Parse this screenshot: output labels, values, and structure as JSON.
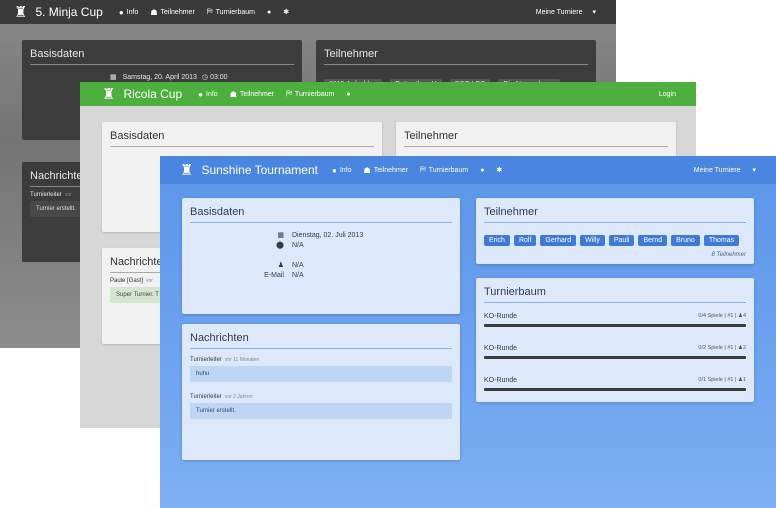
{
  "w1": {
    "title": "5. Minja Cup",
    "nav": [
      "Info",
      "Teilnehmer",
      "Turnierbaum"
    ],
    "user_menu": "Meine Turniere",
    "basis_title": "Basisdaten",
    "date": "Samstag, 20. April 2013",
    "time": "03:00",
    "participants_title": "Teilnehmer",
    "participants": [
      "0815 Aufschlag",
      "Better than U",
      "BSG LBS",
      "Die Namenlosen"
    ],
    "messages_title": "Nachrichten",
    "msg_author": "Turnierleiter",
    "msg_time": "vor",
    "msg_text": "Turnier erstellt."
  },
  "w2": {
    "title": "Ricola Cup",
    "nav": [
      "Info",
      "Teilnehmer",
      "Turnierbaum"
    ],
    "login": "Login",
    "basis_title": "Basisdaten",
    "participants_title": "Teilnehmer",
    "messages_title": "Nachrichten",
    "msg_author": "Paule [Gast]",
    "msg_time": "vor",
    "msg_text": "Super Turnier. T"
  },
  "w3": {
    "title": "Sunshine Tournament",
    "nav": [
      "Info",
      "Teilnehmer",
      "Turnierbaum"
    ],
    "user_menu": "Meine Turniere",
    "basis_title": "Basisdaten",
    "date": "Dienstag, 02. Juli 2013",
    "location": "N/A",
    "person": "N/A",
    "email_label": "E-Mail",
    "email": "N/A",
    "messages_title": "Nachrichten",
    "messages": [
      {
        "author": "Turnierleiter",
        "time": "vor 11 Monaten",
        "text": "huhu"
      },
      {
        "author": "Turnierleiter",
        "time": "vor 2 Jahren",
        "text": "Turnier erstellt."
      }
    ],
    "participants_title": "Teilnehmer",
    "participants": [
      "Erich",
      "Rolf",
      "Gerhard",
      "Willy",
      "Pauli",
      "Bernd",
      "Bruno",
      "Thomas"
    ],
    "participants_count": "8 Teilnehmer",
    "bracket_title": "Turnierbaum",
    "rounds": [
      {
        "name": "KO-Runde",
        "games": "0/4 Spiele",
        "num": "#1",
        "players": "4"
      },
      {
        "name": "KO-Runde",
        "games": "0/2 Spiele",
        "num": "#1",
        "players": "2"
      },
      {
        "name": "KO-Runde",
        "games": "0/1 Spiele",
        "num": "#1",
        "players": "1"
      }
    ]
  }
}
